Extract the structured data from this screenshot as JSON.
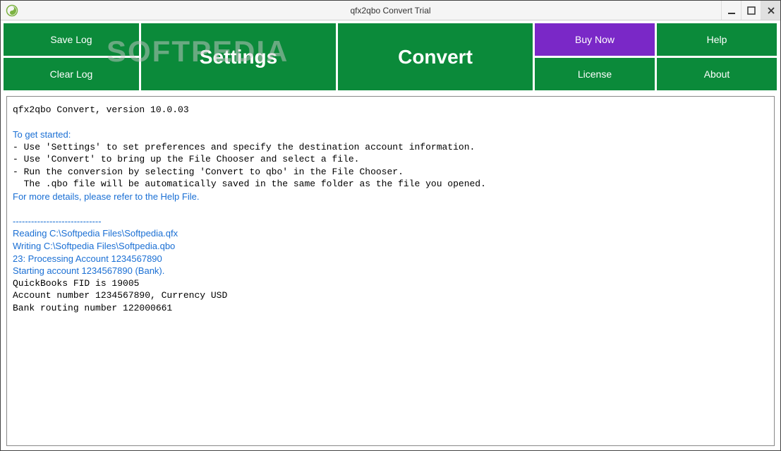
{
  "window": {
    "title": "qfx2qbo Convert Trial"
  },
  "toolbar": {
    "save_log": "Save Log",
    "clear_log": "Clear Log",
    "settings": "Settings",
    "convert": "Convert",
    "buy_now": "Buy Now",
    "license": "License",
    "help": "Help",
    "about": "About"
  },
  "log": {
    "line1": "qfx2qbo Convert, version 10.0.03",
    "line2": "To get started:",
    "line3": "- Use 'Settings' to set preferences and specify the destination account information.",
    "line4": "- Use 'Convert' to bring up the File Chooser and select a file.",
    "line5": "- Run the conversion by selecting 'Convert to qbo' in the File Chooser.",
    "line6": "  The .qbo file will be automatically saved in the same folder as the file you opened.",
    "line7": "For more details, please refer to the Help File.",
    "line8": "-----------------------------",
    "line9": "Reading C:\\Softpedia Files\\Softpedia.qfx",
    "line10": "Writing C:\\Softpedia Files\\Softpedia.qbo",
    "line11": "23: Processing Account 1234567890",
    "line12": "Starting account 1234567890 (Bank).",
    "line13": "QuickBooks FID is 19005",
    "line14": "Account number 1234567890, Currency USD",
    "line15": "Bank routing number 122000661"
  },
  "watermark": "SOFTPEDIA"
}
